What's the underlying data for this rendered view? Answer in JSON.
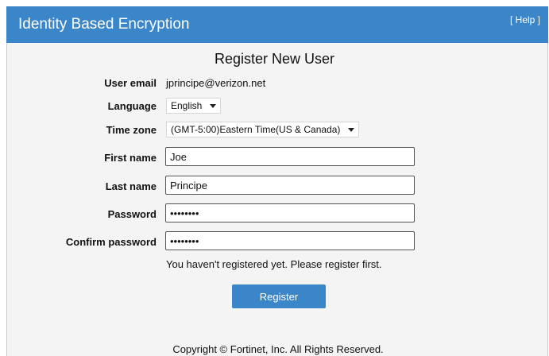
{
  "header": {
    "title": "Identity Based Encryption",
    "help": "[ Help ]"
  },
  "form": {
    "heading": "Register New User",
    "user_email_label": "User email",
    "user_email_value": "jprincipe@verizon.net",
    "language_label": "Language",
    "language_value": "English",
    "timezone_label": "Time zone",
    "timezone_value": "(GMT-5:00)Eastern Time(US & Canada)",
    "first_name_label": "First name",
    "first_name_value": "Joe",
    "last_name_label": "Last name",
    "last_name_value": "Principe",
    "password_label": "Password",
    "password_value": "••••••••",
    "confirm_label": "Confirm password",
    "confirm_value": "••••••••",
    "note": "You haven't registered yet. Please register first.",
    "register_label": "Register"
  },
  "footer": {
    "copyright": "Copyright © Fortinet, Inc. All Rights Reserved."
  },
  "colors": {
    "accent": "#3a86c8",
    "panel_bg": "#f4f4f4"
  }
}
